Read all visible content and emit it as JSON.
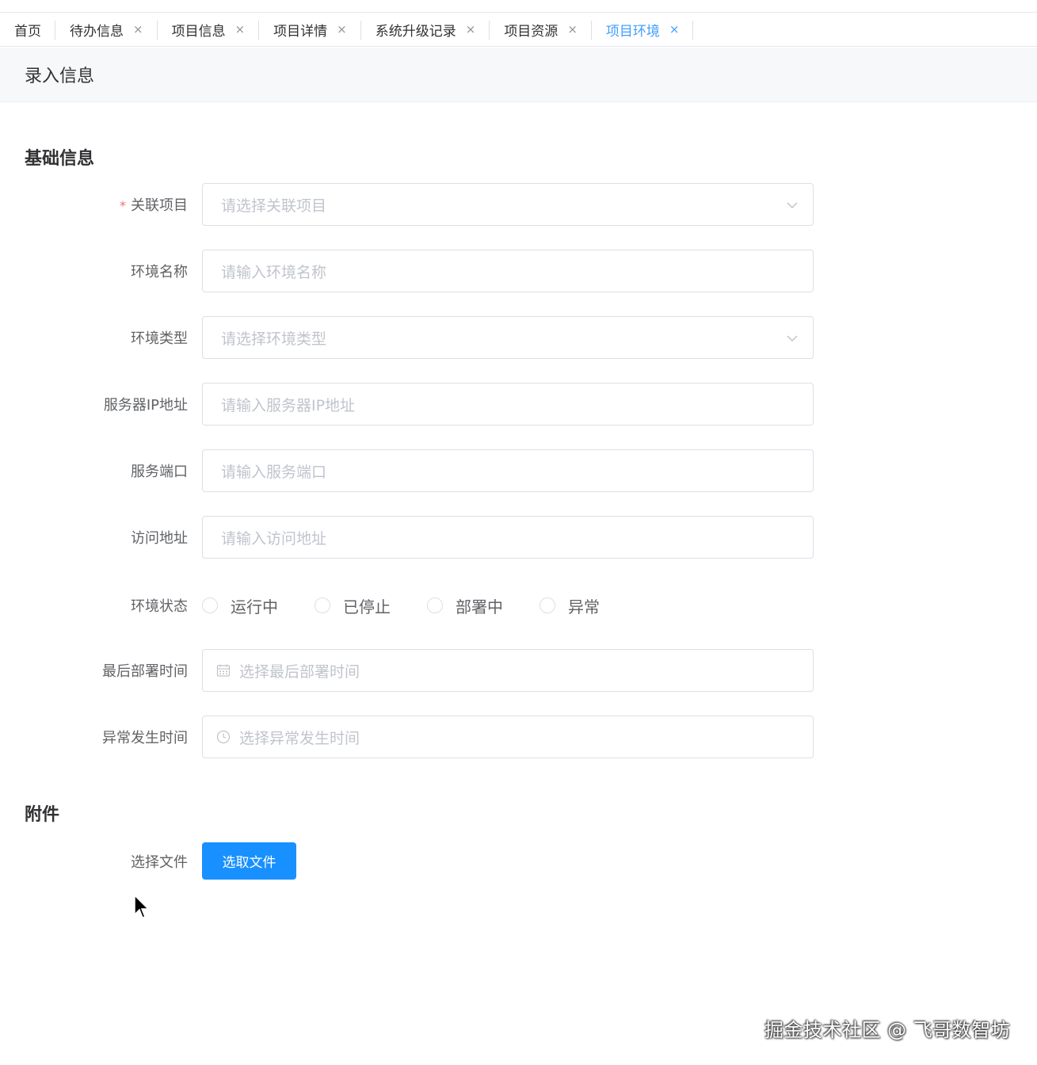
{
  "tabs": [
    {
      "label": "首页",
      "closable": false,
      "active": false
    },
    {
      "label": "待办信息",
      "closable": true,
      "active": false
    },
    {
      "label": "项目信息",
      "closable": true,
      "active": false
    },
    {
      "label": "项目详情",
      "closable": true,
      "active": false
    },
    {
      "label": "系统升级记录",
      "closable": true,
      "active": false
    },
    {
      "label": "项目资源",
      "closable": true,
      "active": false
    },
    {
      "label": "项目环境",
      "closable": true,
      "active": true
    }
  ],
  "tab_close_glyph": "×",
  "page_title": "录入信息",
  "sections": {
    "basic": "基础信息",
    "attachment": "附件"
  },
  "form": {
    "project": {
      "label": "关联项目",
      "required_mark": "*",
      "placeholder": "请选择关联项目",
      "icon": "chevron-down-icon"
    },
    "env_name": {
      "label": "环境名称",
      "placeholder": "请输入环境名称"
    },
    "env_type": {
      "label": "环境类型",
      "placeholder": "请选择环境类型",
      "icon": "chevron-down-icon"
    },
    "server_ip": {
      "label": "服务器IP地址",
      "placeholder": "请输入服务器IP地址"
    },
    "port": {
      "label": "服务端口",
      "placeholder": "请输入服务端口"
    },
    "access_url": {
      "label": "访问地址",
      "placeholder": "请输入访问地址"
    },
    "status": {
      "label": "环境状态",
      "options": [
        "运行中",
        "已停止",
        "部署中",
        "异常"
      ],
      "selected": null
    },
    "last_deploy_time": {
      "label": "最后部署时间",
      "placeholder": "选择最后部署时间",
      "icon": "calendar-icon"
    },
    "error_time": {
      "label": "异常发生时间",
      "placeholder": "选择异常发生时间",
      "icon": "clock-icon"
    },
    "file": {
      "label": "选择文件",
      "button": "选取文件"
    }
  },
  "colors": {
    "primary": "#1890ff",
    "active_tab": "#409eff",
    "required": "#f56c6c",
    "placeholder": "#c0c4cc"
  },
  "watermark": "掘金技术社区 @ 飞哥数智坊"
}
